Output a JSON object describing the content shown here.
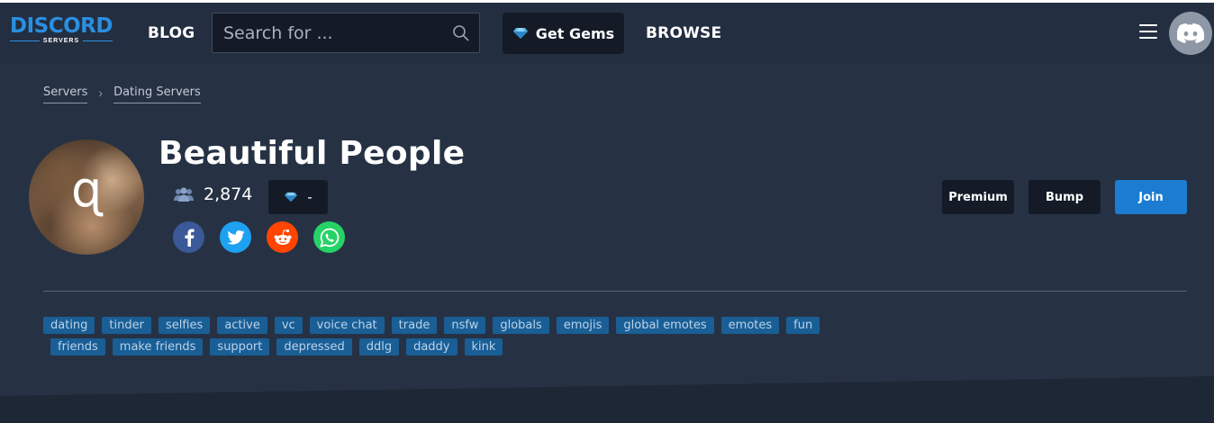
{
  "nav": {
    "logo_main": "DISCORD",
    "logo_sub": "SERVERS",
    "blog": "BLOG",
    "search_placeholder": "Search for ...",
    "gems": "Get Gems",
    "browse": "BROWSE"
  },
  "breadcrumb": [
    "Servers",
    "Dating Servers"
  ],
  "server": {
    "icon_glyph": "ɋ",
    "name": "Beautiful People",
    "member_count": "2,874",
    "gems_value": "-"
  },
  "actions": {
    "premium": "Premium",
    "bump": "Bump",
    "join": "Join"
  },
  "tags_row1": [
    "dating",
    "tinder",
    "selfies",
    "active",
    "vc",
    "voice chat",
    "trade",
    "nsfw",
    "globals",
    "emojis",
    "global emotes",
    "emotes",
    "fun"
  ],
  "tags_row2": [
    "friends",
    "make friends",
    "support",
    "depressed",
    "ddlg",
    "daddy",
    "kink"
  ],
  "colors": {
    "page_bg": "#263244",
    "nav_bg": "#232e40",
    "dark_button": "#141b27",
    "join_blue": "#1c7cd1",
    "tag_bg": "#1a5e96",
    "facebook": "#3b5998",
    "twitter": "#1da1f2",
    "reddit": "#ff4500",
    "whatsapp": "#25d366"
  }
}
